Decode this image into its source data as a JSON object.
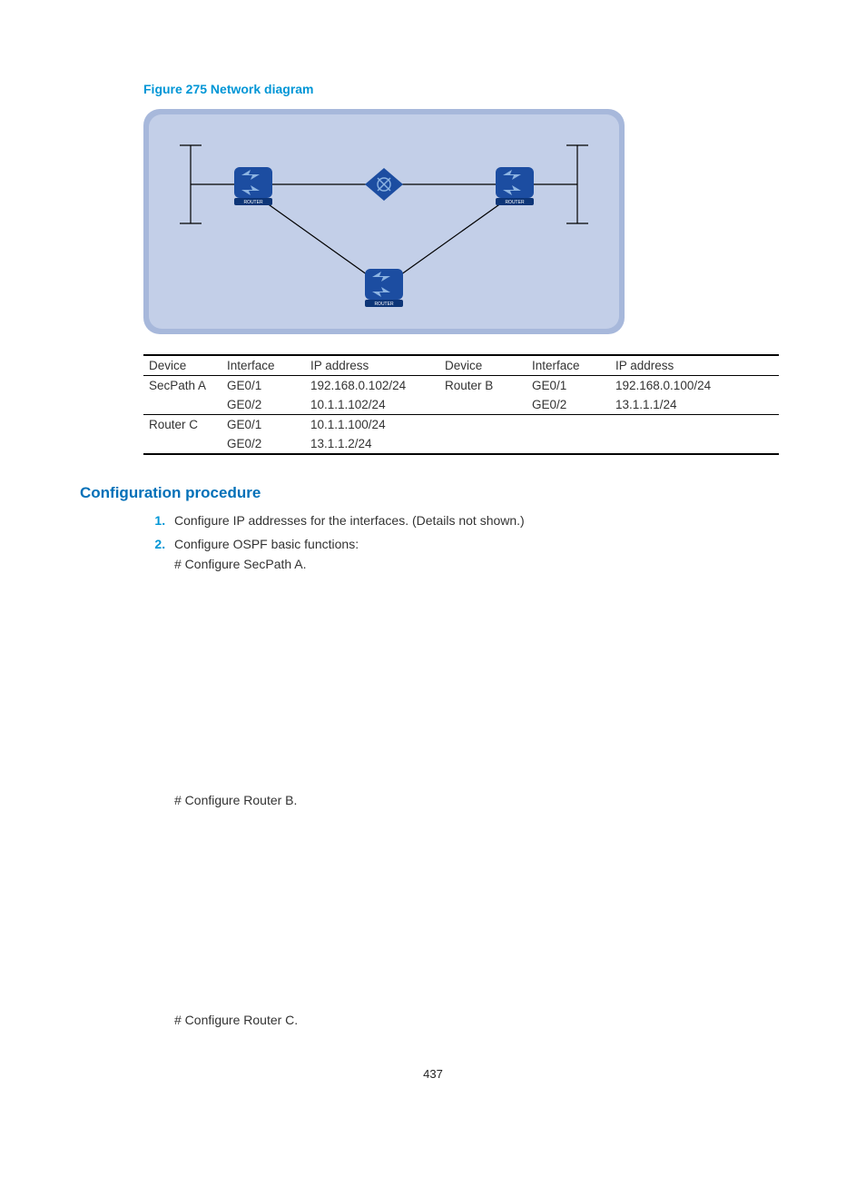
{
  "figure_title": "Figure 275 Network diagram",
  "table": {
    "headers": [
      "Device",
      "Interface",
      "IP address",
      "Device",
      "Interface",
      "IP address"
    ],
    "rows": [
      [
        "SecPath A",
        "GE0/1",
        "192.168.0.102/24",
        "Router B",
        "GE0/1",
        "192.168.0.100/24"
      ],
      [
        "",
        "GE0/2",
        "10.1.1.102/24",
        "",
        "GE0/2",
        "13.1.1.1/24"
      ],
      [
        "Router C",
        "GE0/1",
        "10.1.1.100/24",
        "",
        "",
        ""
      ],
      [
        "",
        "GE0/2",
        "13.1.1.2/24",
        "",
        "",
        ""
      ]
    ]
  },
  "section_heading": "Configuration procedure",
  "steps": {
    "s1": "Configure IP addresses for the interfaces. (Details not shown.)",
    "s2": "Configure OSPF basic functions:",
    "s2a": "# Configure SecPath A.",
    "s2b": "# Configure Router B.",
    "s2c": "# Configure Router C."
  },
  "page_number": "437"
}
